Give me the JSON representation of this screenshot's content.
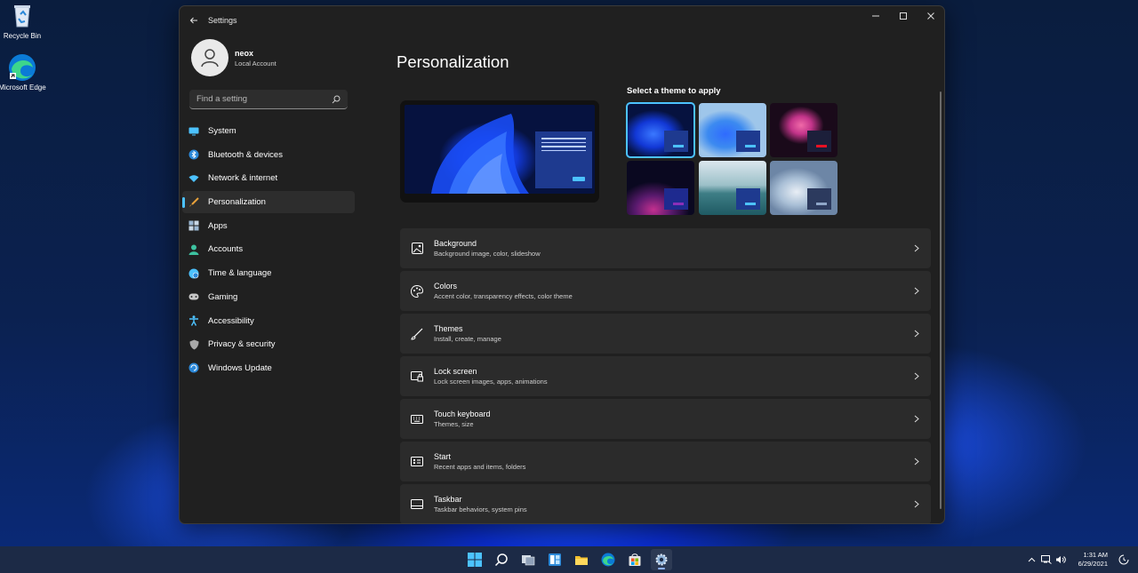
{
  "desktop": {
    "icons": [
      {
        "label": "Recycle Bin"
      },
      {
        "label": "Microsoft Edge"
      }
    ]
  },
  "window": {
    "title": "Settings"
  },
  "profile": {
    "name": "neox",
    "account_type": "Local Account"
  },
  "search": {
    "placeholder": "Find a setting"
  },
  "nav": {
    "items": [
      {
        "label": "System",
        "icon": "monitor-icon",
        "color": "#4cc2ff"
      },
      {
        "label": "Bluetooth & devices",
        "icon": "bluetooth-icon",
        "color": "#2b88d8"
      },
      {
        "label": "Network & internet",
        "icon": "wifi-icon",
        "color": "#4cc2ff"
      },
      {
        "label": "Personalization",
        "icon": "brush-icon",
        "color": "#e8a13a",
        "active": true
      },
      {
        "label": "Apps",
        "icon": "apps-icon",
        "color": "#9ab7d3"
      },
      {
        "label": "Accounts",
        "icon": "person-icon",
        "color": "#3dc2a0"
      },
      {
        "label": "Time & language",
        "icon": "globe-clock-icon",
        "color": "#4cc2ff"
      },
      {
        "label": "Gaming",
        "icon": "gamepad-icon",
        "color": "#c8c8c8"
      },
      {
        "label": "Accessibility",
        "icon": "accessibility-icon",
        "color": "#4cc2ff"
      },
      {
        "label": "Privacy & security",
        "icon": "shield-icon",
        "color": "#a8a8a8"
      },
      {
        "label": "Windows Update",
        "icon": "update-icon",
        "color": "#2b88d8"
      }
    ]
  },
  "main": {
    "title": "Personalization",
    "themes_label": "Select a theme to apply",
    "cards": [
      {
        "title": "Background",
        "subtitle": "Background image, color, slideshow",
        "icon": "image-icon"
      },
      {
        "title": "Colors",
        "subtitle": "Accent color, transparency effects, color theme",
        "icon": "palette-icon"
      },
      {
        "title": "Themes",
        "subtitle": "Install, create, manage",
        "icon": "brush-icon"
      },
      {
        "title": "Lock screen",
        "subtitle": "Lock screen images, apps, animations",
        "icon": "lock-screen-icon"
      },
      {
        "title": "Touch keyboard",
        "subtitle": "Themes, size",
        "icon": "keyboard-icon"
      },
      {
        "title": "Start",
        "subtitle": "Recent apps and items, folders",
        "icon": "start-icon"
      },
      {
        "title": "Taskbar",
        "subtitle": "Taskbar behaviors, system pins",
        "icon": "taskbar-icon"
      }
    ]
  },
  "taskbar": {
    "time": "1:31 AM",
    "date": "6/29/2021"
  },
  "colors": {
    "accent": "#4cc2ff"
  }
}
